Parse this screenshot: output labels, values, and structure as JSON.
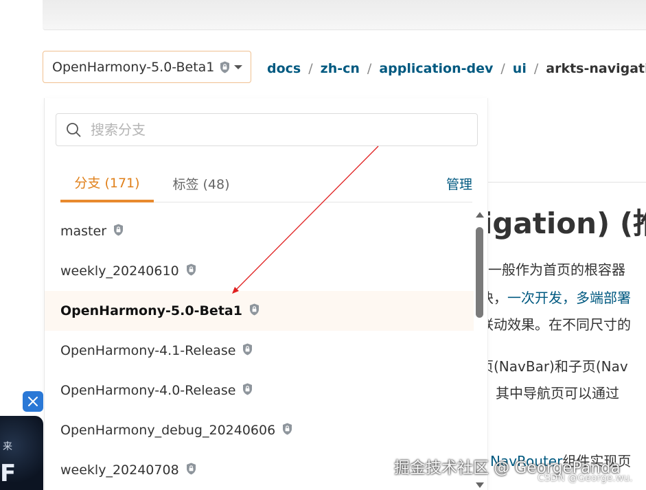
{
  "branch_selector": {
    "selected": "OpenHarmony-5.0-Beta1"
  },
  "breadcrumb": [
    "docs",
    "zh-cn",
    "application-dev",
    "ui",
    "arkts-navigation-"
  ],
  "breadcrumb_separator": "/",
  "dropdown": {
    "search_placeholder": "搜索分支",
    "tabs": {
      "branches": "分支 (171)",
      "tags": "标签 (48)",
      "manage": "管理"
    },
    "branches": [
      {
        "name": "master",
        "locked": true
      },
      {
        "name": "weekly_20240610",
        "locked": true
      },
      {
        "name": "OpenHarmony-5.0-Beta1",
        "locked": true,
        "selected": true
      },
      {
        "name": "OpenHarmony-4.1-Release",
        "locked": true
      },
      {
        "name": "OpenHarmony-4.0-Release",
        "locked": true
      },
      {
        "name": "OpenHarmony_debug_20240606",
        "locked": true
      },
      {
        "name": "weekly_20240708",
        "locked": true
      }
    ]
  },
  "doc_background": {
    "heading": "igation) (推",
    "line1": "一般作为首页的根容器",
    "line2_prefix": "块，",
    "line2_link": "一次开发，多端部署",
    "line3": "联动效果。在不同尺寸的",
    "line4": "页(NavBar)和子页(Nav",
    "line5": "其中导航页可以通过",
    "line6_link": "NavRouter",
    "line6_suffix": "组件实现页"
  },
  "promo": {
    "text": "来",
    "glyph": "F"
  },
  "watermarks": {
    "juejin": "掘金技术社区 @ GeorgePanda",
    "csdn": "CSDN @George.wu."
  },
  "colors": {
    "accent_orange": "#e88a2e",
    "link_teal": "#005980",
    "selected_row_bg": "#fef8f2",
    "annotation_red": "#e02020"
  }
}
